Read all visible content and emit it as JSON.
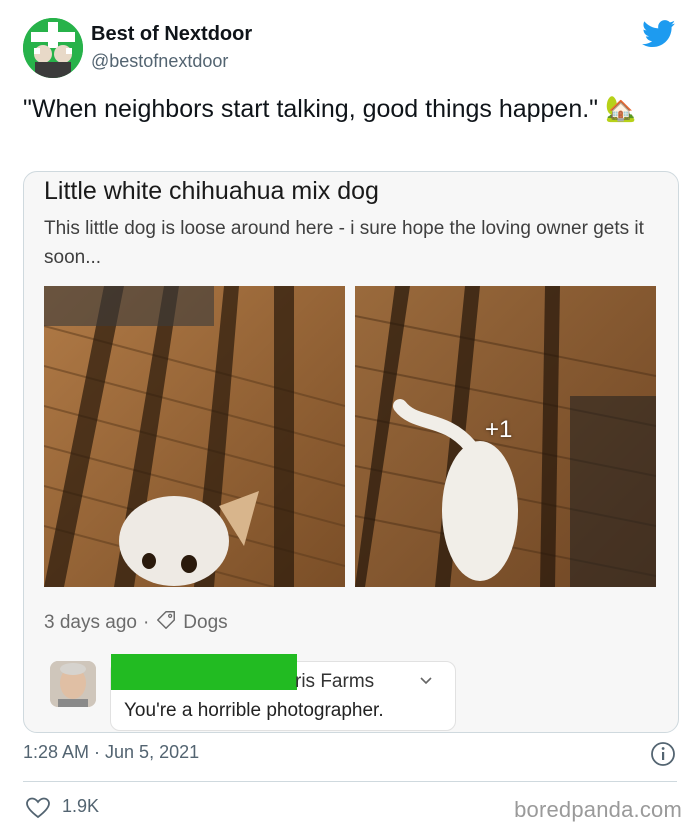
{
  "account": {
    "name": "Best of Nextdoor",
    "handle": "@bestofnextdoor"
  },
  "tweet": {
    "text": "\"When neighbors start talking, good things happen.\"",
    "emoji": "🏡"
  },
  "card": {
    "title": "Little white chihuahua mix dog",
    "body": "This little dog is loose around here - i sure hope the loving owner gets it soon...",
    "photo_overlay": "+1",
    "posted": "3 days ago",
    "separator": "·",
    "category": "Dogs",
    "comment": {
      "author": "ris Farms",
      "text": "You're a horrible photographer."
    }
  },
  "footer": {
    "timestamp": "1:28 AM · Jun 5, 2021",
    "likes": "1.9K",
    "watermark": "boredpanda.com"
  },
  "colors": {
    "twitter_blue": "#1d9bf0",
    "nextdoor_green": "#27b24a",
    "redaction_green": "#22bb22"
  }
}
